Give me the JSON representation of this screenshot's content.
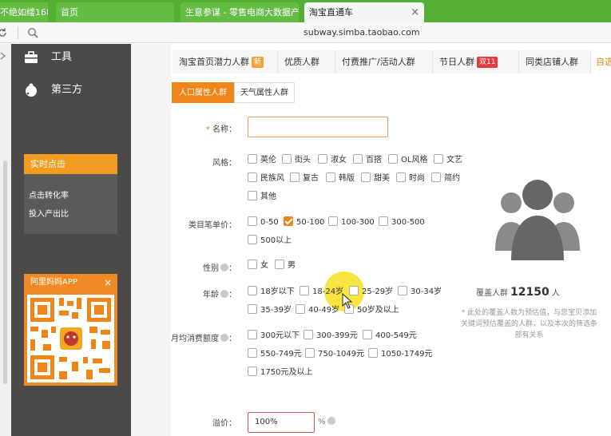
{
  "browser": {
    "tabs": [
      {
        "label": "不绝如缕168",
        "state": "partial"
      },
      {
        "label": "首页",
        "state": "normal"
      },
      {
        "label": "生意参谋 - 零售电商大数据产",
        "state": "normal"
      },
      {
        "label": "淘宝直通车",
        "state": "active"
      }
    ],
    "close_glyph": "×",
    "url": "subway.simba.taobao.com",
    "accent": "#53b033"
  },
  "sidebar": {
    "items": [
      {
        "label": "工具",
        "icon": "toolbox-icon"
      },
      {
        "label": "第三方",
        "icon": "puzzle-icon"
      }
    ],
    "realtime": {
      "title": "实时点击",
      "links": [
        "点击转化率",
        "投入产出比"
      ]
    },
    "app_promo": {
      "title": "阿里妈妈APP",
      "close": "×"
    }
  },
  "crowd_tabs": [
    {
      "label": "淘宝首页潜力人群",
      "badge": "新"
    },
    {
      "label": "优质人群"
    },
    {
      "label": "付费推广/活动人群"
    },
    {
      "label": "节日人群",
      "badge": "双11"
    },
    {
      "label": "同类店铺人群"
    },
    {
      "label": "自选"
    }
  ],
  "sub_tabs": [
    {
      "label": "人口属性人群",
      "selected": true
    },
    {
      "label": "天气属性人群",
      "selected": false
    }
  ],
  "form": {
    "name": {
      "label": "名称",
      "required_mark": "*",
      "colon": "：",
      "value": ""
    },
    "style": {
      "label": "风格：",
      "options": [
        "英伦",
        "街头",
        "淑女",
        "百搭",
        "OL风格",
        "文艺",
        "民族风",
        "复古",
        "韩版",
        "甜美",
        "时尚",
        "简约",
        "其他"
      ]
    },
    "category_price": {
      "label": "类目笔单价：",
      "options": [
        "0-50",
        "50-100",
        "100-300",
        "300-500",
        "500以上"
      ],
      "checked": "50-100"
    },
    "gender": {
      "label": "性别",
      "colon": "：",
      "options": [
        "女",
        "男"
      ]
    },
    "age": {
      "label": "年龄",
      "colon": "：",
      "options": [
        "18岁以下",
        "18-24岁",
        "25-29岁",
        "30-34岁",
        "35-39岁",
        "40-49岁",
        "50岁及以上"
      ]
    },
    "monthly_spend": {
      "label": "月均消费额度",
      "colon": "：",
      "options": [
        "300元以下",
        "300-399元",
        "400-549元",
        "550-749元",
        "750-1049元",
        "1050-1749元",
        "1750元及以上"
      ]
    },
    "premium": {
      "label": "溢价：",
      "value": "100%",
      "unit": "%"
    }
  },
  "coverage": {
    "prefix": "覆盖人群",
    "count": "12150",
    "suffix": "人",
    "note_lines": [
      "* 此处的覆盖人数为预估值，与您宝贝添加",
      "关键词预估覆盖的人群，以及本次的筛选条",
      "部有关系"
    ]
  },
  "colors": {
    "orange": "#f08519",
    "sidebar": "#4c4a48",
    "badge_new": "#f0a33c",
    "badge_11": "#e4393c"
  }
}
